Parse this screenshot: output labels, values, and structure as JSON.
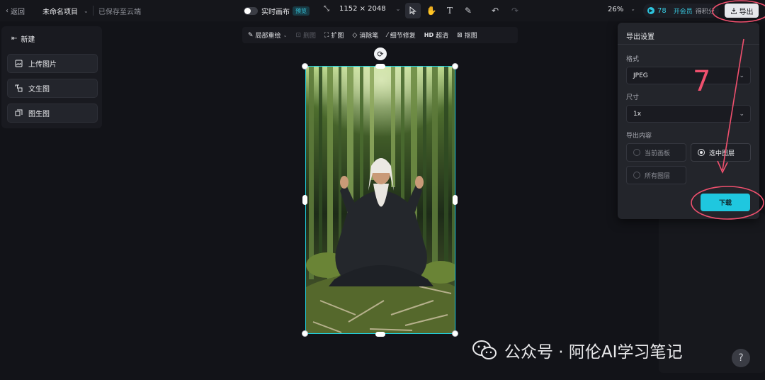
{
  "topbar": {
    "back_label": "返回",
    "project_title": "未命名项目",
    "saved_status": "已保存至云端",
    "realtime_label": "实时画布",
    "realtime_badge": "预览",
    "canvas_size": "1152 × 2048",
    "zoom": "26%",
    "points": "78",
    "member_label": "开会员",
    "earn_label": "得积分",
    "export_label": "导出"
  },
  "left_panel": {
    "new_label": "新建",
    "buttons": [
      "上传图片",
      "文生图",
      "图生图"
    ]
  },
  "edit_toolbar": {
    "items": [
      {
        "label": "局部重绘",
        "icon": "brush-icon",
        "enabled": true
      },
      {
        "label": "删图",
        "icon": "delete-icon",
        "enabled": false
      },
      {
        "label": "扩图",
        "icon": "expand-icon",
        "enabled": true
      },
      {
        "label": "消除笔",
        "icon": "eraser-icon",
        "enabled": true
      },
      {
        "label": "细节修复",
        "icon": "wand-icon",
        "enabled": true
      },
      {
        "label": "超清",
        "prefix": "HD",
        "icon": "hd-icon",
        "enabled": true
      },
      {
        "label": "抠图",
        "icon": "cutout-icon",
        "enabled": true
      }
    ]
  },
  "export_panel": {
    "title": "导出设置",
    "format_label": "格式",
    "format_value": "JPEG",
    "size_label": "尺寸",
    "size_value": "1x",
    "content_label": "导出内容",
    "content_options": [
      "当前画板",
      "选中图层",
      "所有图层"
    ],
    "selected_option": "选中图层",
    "download_label": "下载"
  },
  "annotation": {
    "step_number": "7",
    "color": "#f0506e"
  },
  "watermark": "公众号 · 阿伦AI学习笔记",
  "colors": {
    "accent": "#1fc7df",
    "selection": "#20d0df",
    "background": "#121318"
  }
}
